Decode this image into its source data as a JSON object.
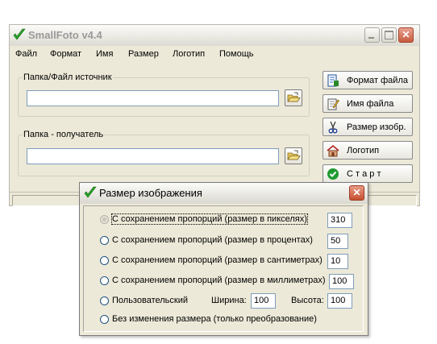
{
  "app": {
    "title": "SmallFoto v4.4"
  },
  "menu": [
    "Файл",
    "Формат",
    "Имя",
    "Размер",
    "Логотип",
    "Помощь"
  ],
  "source_group": {
    "label": "Папка/Файл источник",
    "value": ""
  },
  "dest_group": {
    "label": "Папка - получатель",
    "value": ""
  },
  "side_buttons": {
    "format": "Формат файла",
    "name": "Имя файла",
    "size": "Размер изобр.",
    "logo": "Логотип",
    "start": "С т а р т"
  },
  "dialog": {
    "title": "Размер изображения",
    "options": [
      {
        "label": "С сохранением пропорций (размер в пикселях)",
        "value": "310",
        "selected": true
      },
      {
        "label": "С сохранением пропорций (размер в процентах)",
        "value": "50"
      },
      {
        "label": "С сохранением пропорций (размер в сантиметрах)",
        "value": "10"
      },
      {
        "label": "С сохранением пропорций (размер в миллиметрах)",
        "value": "100"
      },
      {
        "label": "Пользовательский"
      },
      {
        "label": "Без изменения размера (только преобразование)"
      }
    ],
    "custom": {
      "width_label": "Ширина:",
      "width_value": "100",
      "height_label": "Высота:",
      "height_value": "100"
    }
  },
  "colors": {
    "window_bg": "#ece9d8",
    "close_red": "#c75a3e",
    "check_green": "#2aa12a"
  }
}
